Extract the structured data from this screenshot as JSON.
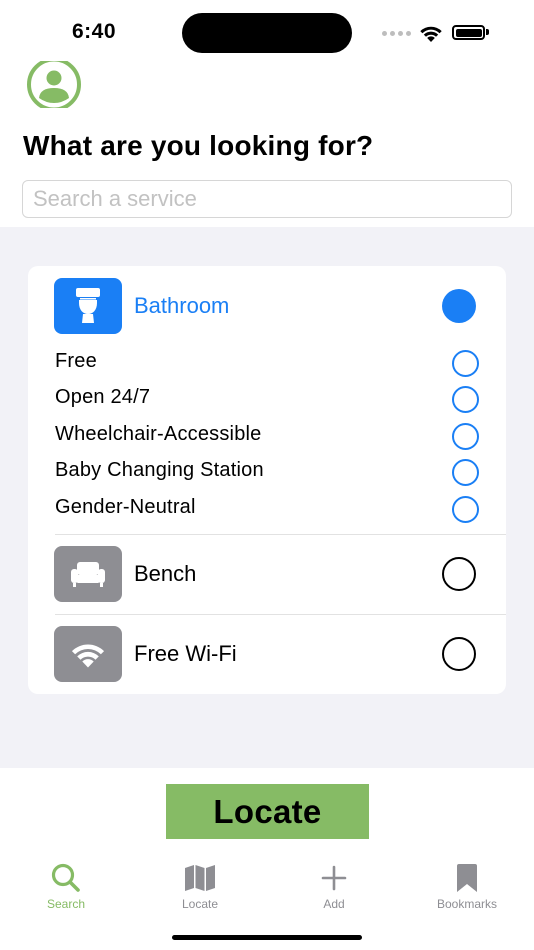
{
  "status_bar": {
    "time": "6:40"
  },
  "header": {
    "title": "What are you looking for?",
    "search_placeholder": "Search a service"
  },
  "services": [
    {
      "label": "Bathroom",
      "icon": "toilet-icon",
      "selected": true,
      "filters": [
        {
          "label": "Free",
          "selected": false
        },
        {
          "label": "Open 24/7",
          "selected": false
        },
        {
          "label": "Wheelchair-Accessible",
          "selected": false
        },
        {
          "label": "Baby Changing Station",
          "selected": false
        },
        {
          "label": "Gender-Neutral",
          "selected": false
        }
      ]
    },
    {
      "label": "Bench",
      "icon": "bench-icon",
      "selected": false
    },
    {
      "label": "Free Wi-Fi",
      "icon": "wifi-icon",
      "selected": false
    }
  ],
  "locate_button": {
    "label": "Locate"
  },
  "tab_bar": [
    {
      "label": "Search",
      "icon": "search-icon",
      "active": true
    },
    {
      "label": "Locate",
      "icon": "map-icon",
      "active": false
    },
    {
      "label": "Add",
      "icon": "plus-icon",
      "active": false
    },
    {
      "label": "Bookmarks",
      "icon": "bookmark-icon",
      "active": false
    }
  ],
  "colors": {
    "accent_green": "#86bb65",
    "selected_blue": "#1a7ff5",
    "inactive_gray": "#8e8e93",
    "group_background": "#f2f2f7"
  }
}
